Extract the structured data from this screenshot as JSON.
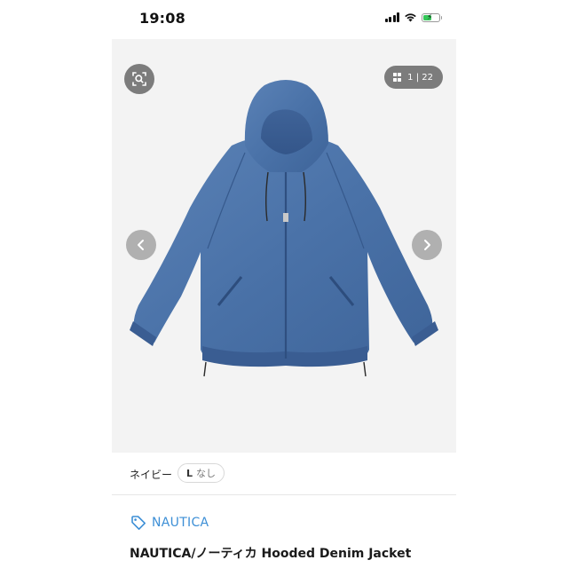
{
  "status_bar": {
    "time": "19:08",
    "battery_level": 0.55,
    "battery_color": "#35c759"
  },
  "gallery": {
    "counter_text": "1 | 22",
    "zoom_icon": "zoom-search-icon",
    "grid_icon": "grid-icon",
    "prev_icon": "chevron-left-icon",
    "next_icon": "chevron-right-icon",
    "image_subject": "denim-hooded-jacket"
  },
  "variant": {
    "color": "ネイビー",
    "size": "L",
    "stock": "なし"
  },
  "brand": {
    "name": "NAUTICA",
    "icon": "tag-icon",
    "color": "#3d8fd6"
  },
  "product": {
    "title": "NAUTICA/ノーティカ Hooded Denim Jacket"
  }
}
